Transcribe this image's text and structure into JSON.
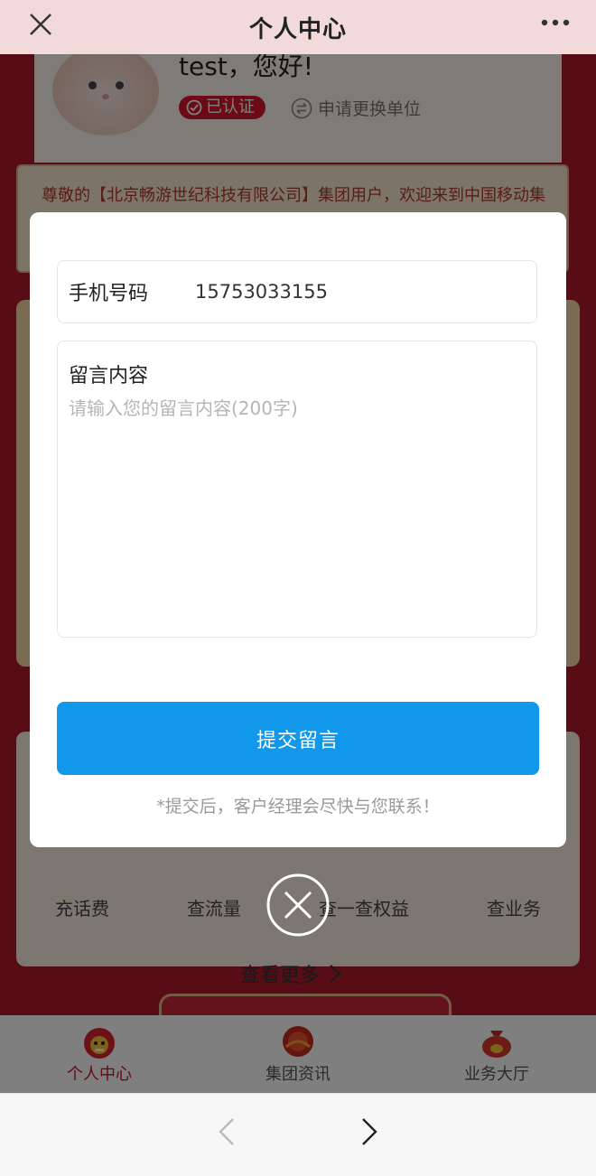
{
  "topbar": {
    "title": "个人中心",
    "close_icon": "close-icon",
    "more_icon": "more-icon"
  },
  "profile": {
    "greeting": "test，您好!",
    "badge": "已认证",
    "change_unit": "申请更换单位"
  },
  "notice": {
    "text": "尊敬的【北京畅游世纪科技有限公司】集团用户，欢迎来到中国移动集团客户服务门户……"
  },
  "services": {
    "items": [
      "充话费",
      "查流量",
      "查一查权益",
      "查业务"
    ],
    "view_more": "查看更多"
  },
  "tabbar": {
    "items": [
      {
        "label": "个人中心",
        "icon": "lion-icon",
        "active": true
      },
      {
        "label": "集团资讯",
        "icon": "news-icon",
        "active": false
      },
      {
        "label": "业务大厅",
        "icon": "money-bag-icon",
        "active": false
      }
    ]
  },
  "dialog": {
    "phone_label": "手机号码",
    "phone_value": "15753033155",
    "message_label": "留言内容",
    "message_placeholder": "请输入您的留言内容(200字)",
    "submit_label": "提交留言",
    "hint": "*提交后，客户经理会尽快与您联系！"
  },
  "colors": {
    "primary_button": "#1298ea",
    "brand_red": "#c8162a",
    "topbar_bg": "#f3dada"
  }
}
